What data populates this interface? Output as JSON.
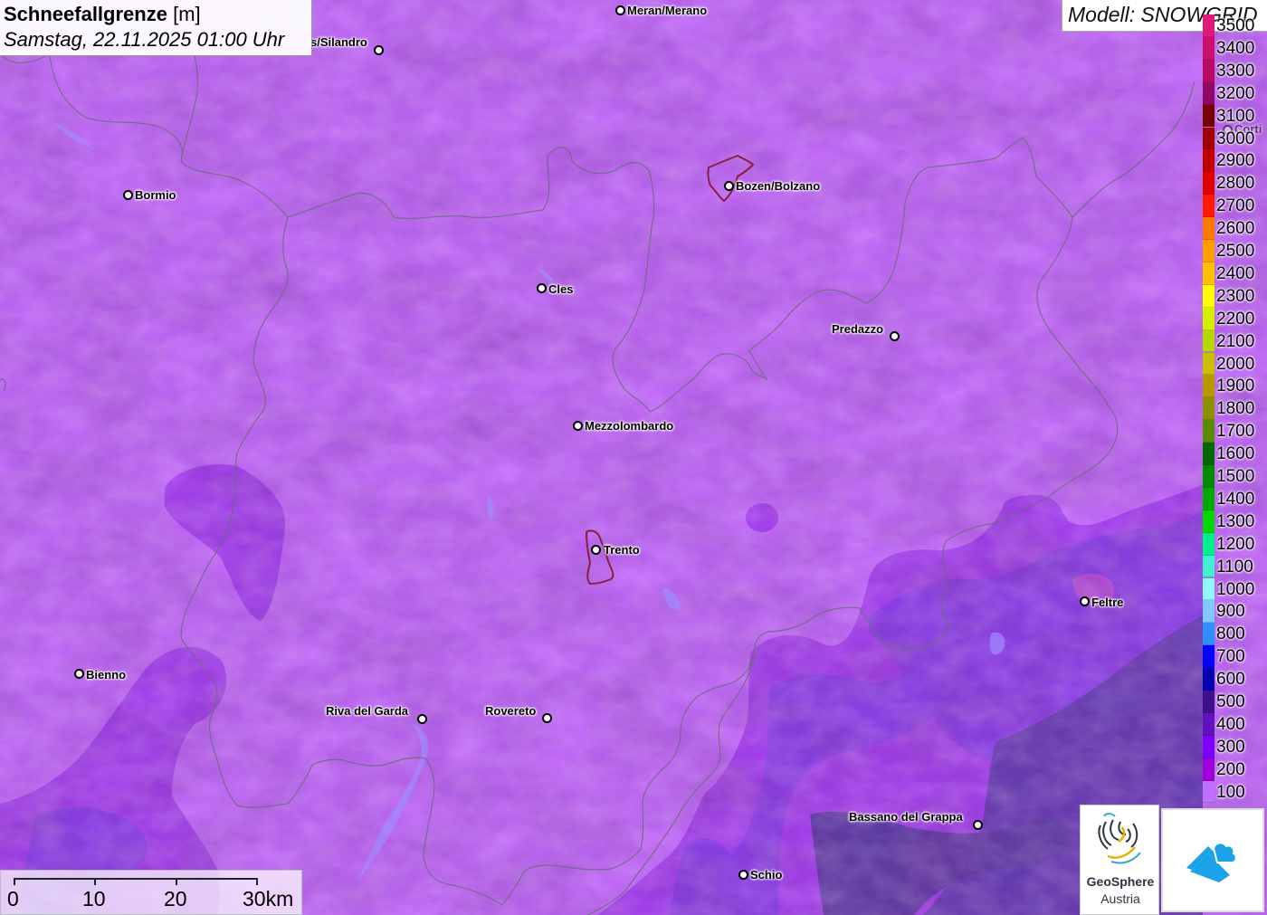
{
  "title": {
    "variable": "Schneefallgrenze",
    "unit": "[m]",
    "datetime": "Samstag, 22.11.2025 01:00 Uhr"
  },
  "model": "Modell: SNOWGRID",
  "legend": {
    "unit": "m",
    "items": [
      {
        "label": "3500",
        "color": "#e01878"
      },
      {
        "label": "3400",
        "color": "#cc106c"
      },
      {
        "label": "3300",
        "color": "#b80a60"
      },
      {
        "label": "3200",
        "color": "#8f0868"
      },
      {
        "label": "3100",
        "color": "#7a0000"
      },
      {
        "label": "3000",
        "color": "#a00000"
      },
      {
        "label": "2900",
        "color": "#c00000"
      },
      {
        "label": "2800",
        "color": "#e00000"
      },
      {
        "label": "2700",
        "color": "#ff1a00"
      },
      {
        "label": "2600",
        "color": "#ff7a00"
      },
      {
        "label": "2500",
        "color": "#ff9e00"
      },
      {
        "label": "2400",
        "color": "#ffc000"
      },
      {
        "label": "2300",
        "color": "#ffff00"
      },
      {
        "label": "2200",
        "color": "#d4f000"
      },
      {
        "label": "2100",
        "color": "#b4d800"
      },
      {
        "label": "2000",
        "color": "#c8c000"
      },
      {
        "label": "1900",
        "color": "#b89800"
      },
      {
        "label": "1800",
        "color": "#8c9000"
      },
      {
        "label": "1700",
        "color": "#5a8a00"
      },
      {
        "label": "1600",
        "color": "#006800"
      },
      {
        "label": "1500",
        "color": "#008a00"
      },
      {
        "label": "1400",
        "color": "#00aa00"
      },
      {
        "label": "1300",
        "color": "#00d800"
      },
      {
        "label": "1200",
        "color": "#00f090"
      },
      {
        "label": "1100",
        "color": "#40f0d0"
      },
      {
        "label": "1000",
        "color": "#90f8ff"
      },
      {
        "label": "900",
        "color": "#80c8ff"
      },
      {
        "label": "800",
        "color": "#3090ff"
      },
      {
        "label": "700",
        "color": "#0000ff"
      },
      {
        "label": "600",
        "color": "#0000b0"
      },
      {
        "label": "500",
        "color": "#40108a"
      },
      {
        "label": "400",
        "color": "#6010c0"
      },
      {
        "label": "300",
        "color": "#8000ff"
      },
      {
        "label": "200",
        "color": "#a000e0"
      },
      {
        "label": "100",
        "color": "#c070ff"
      }
    ]
  },
  "cities": [
    {
      "id": "meran",
      "name": "Meran/Merano"
    },
    {
      "id": "schlanders",
      "name": "s/Silandro"
    },
    {
      "id": "bormio",
      "name": "Bormio"
    },
    {
      "id": "bozen",
      "name": "Bozen/Bolzano"
    },
    {
      "id": "cles",
      "name": "Cles"
    },
    {
      "id": "predazzo",
      "name": "Predazzo"
    },
    {
      "id": "mezzolombardo",
      "name": "Mezzolombardo"
    },
    {
      "id": "trento",
      "name": "Trento"
    },
    {
      "id": "feltre",
      "name": "Feltre"
    },
    {
      "id": "bienno",
      "name": "Bienno"
    },
    {
      "id": "riva",
      "name": "Riva del Garda"
    },
    {
      "id": "rovereto",
      "name": "Rovereto"
    },
    {
      "id": "bassano",
      "name": "Bassano del Grappa"
    },
    {
      "id": "schio",
      "name": "Schio"
    },
    {
      "id": "cortina",
      "name": "Corti"
    }
  ],
  "scale": {
    "labels": [
      "0",
      "10",
      "20",
      "30km"
    ]
  },
  "logos": {
    "geosphere_line1": "GeoSphere",
    "geosphere_line2": "Austria"
  },
  "colors": {
    "base_fill": "#c36bfb",
    "mid_fill": "#a43ef0",
    "deep_fill": "#8a3ee8",
    "dark_fill": "#623bb0",
    "border": "#6b6b7a",
    "municipality": "#8a2040"
  }
}
